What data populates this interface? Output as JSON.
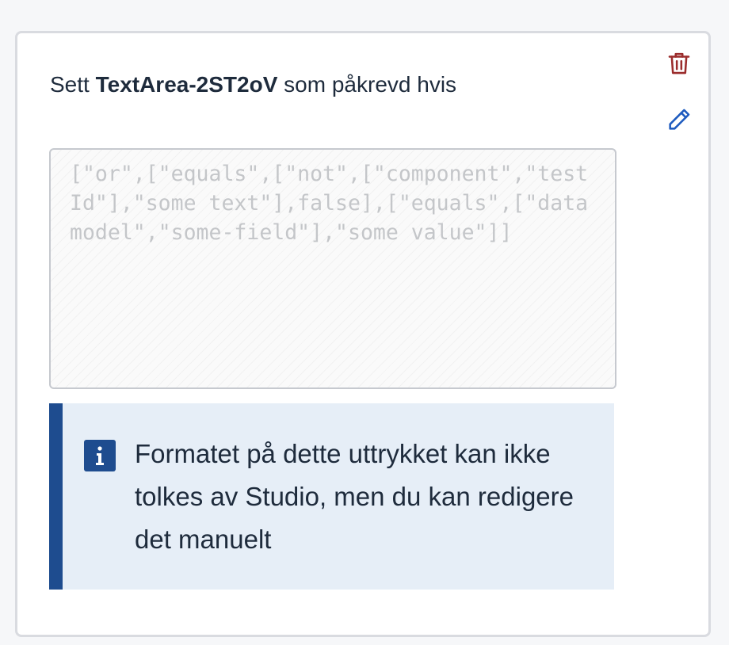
{
  "condition": {
    "prefix": "Sett",
    "component_id": "TextArea-2ST2oV",
    "suffix": "som påkrevd hvis"
  },
  "actions": {
    "delete_icon": "trash-icon",
    "edit_icon": "pencil-icon"
  },
  "expression": {
    "value": "[\"or\",[\"equals\",[\"not\",[\"component\",\"testId\"],\"some text\"],false],[\"equals\",[\"datamodel\",\"some-field\"],\"some value\"]]"
  },
  "alert": {
    "icon": "info-icon",
    "message": "Formatet på dette uttrykket kan ikke tolkes av Studio, men du kan redigere det manuelt"
  },
  "colors": {
    "delete": "#9b2c2c",
    "edit": "#1e5bbf",
    "alert_border": "#1e4c8f",
    "alert_bg": "#e6eef7"
  }
}
